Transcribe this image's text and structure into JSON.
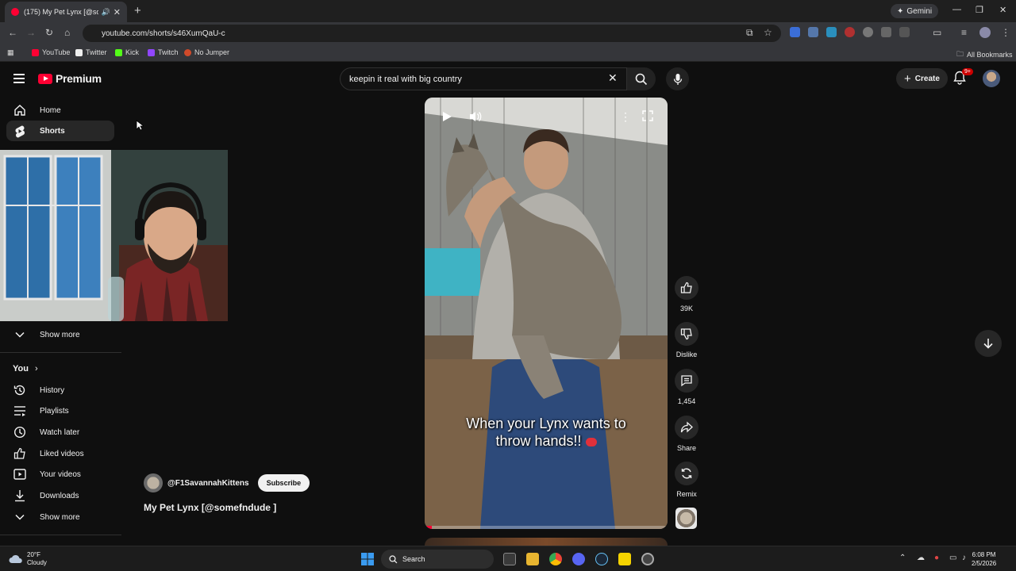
{
  "browser": {
    "tab_title": "(175) My Pet Lynx [@somefnd",
    "url": "youtube.com/shorts/s46XumQaU-c",
    "gemini_label": "Gemini",
    "bookmarks": [
      "YouTube",
      "Twitter",
      "Kick",
      "Twitch",
      "No Jumper"
    ],
    "all_bookmarks": "All Bookmarks"
  },
  "header": {
    "logo_word": "Premium",
    "search_value": "keepin it real with big country",
    "create_label": "Create",
    "notif_badge": "9+"
  },
  "sidebar": {
    "home": "Home",
    "shorts": "Shorts",
    "show_more_1": "Show more",
    "you": "You",
    "history": "History",
    "playlists": "Playlists",
    "watch_later": "Watch later",
    "liked_videos": "Liked videos",
    "your_videos": "Your videos",
    "downloads": "Downloads",
    "show_more_2": "Show more"
  },
  "short": {
    "caption_line1": "When your Lynx wants to",
    "caption_line2": "throw hands!!",
    "channel": "@F1SavannahKittens",
    "subscribe": "Subscribe",
    "title": "My Pet Lynx  [@somefndude ]",
    "likes": "39K",
    "dislike": "Dislike",
    "comments": "1,454",
    "share": "Share",
    "remix": "Remix"
  },
  "taskbar": {
    "temp": "20°F",
    "weather": "Cloudy",
    "search": "Search",
    "time": "6:08 PM",
    "date": "2/5/2026"
  },
  "colors": {
    "brand": "#ff0033",
    "bg": "#0f0f0f",
    "chip": "#272727"
  }
}
